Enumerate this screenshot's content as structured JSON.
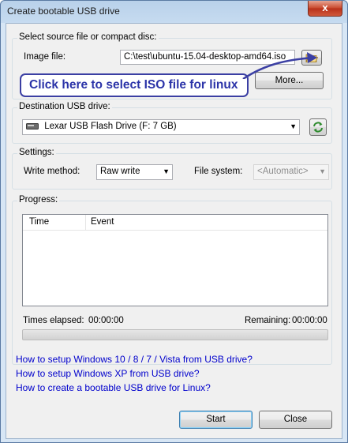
{
  "window": {
    "title": "Create bootable USB drive",
    "close_glyph": "x"
  },
  "source": {
    "legend": "Select source file or compact disc:",
    "image_label": "Image file:",
    "image_value": "C:\\test\\ubuntu-15.04-desktop-amd64.iso",
    "browse_icon": "folder-open-icon",
    "more_label": "More..."
  },
  "annotation": {
    "callout_text": "Click here to select ISO file for linux",
    "color": "#2b33a8"
  },
  "destination": {
    "legend": "Destination USB drive:",
    "selected_drive": "Lexar USB Flash Drive (F: 7 GB)",
    "refresh_icon": "refresh-icon"
  },
  "settings": {
    "legend": "Settings:",
    "write_method_label": "Write method:",
    "write_method_value": "Raw write",
    "file_system_label": "File system:",
    "file_system_value": "<Automatic>"
  },
  "progress": {
    "legend": "Progress:",
    "columns": [
      "Time",
      "Event"
    ],
    "elapsed_label": "Times elapsed:",
    "elapsed_value": "00:00:00",
    "remaining_label": "Remaining:",
    "remaining_value": "00:00:00",
    "percent": 0
  },
  "links": [
    "How to setup Windows 10 / 8 / 7 / Vista from USB drive?",
    "How to setup Windows XP from USB drive?",
    "How to create a bootable USB drive for Linux?"
  ],
  "buttons": {
    "start": "Start",
    "close": "Close"
  },
  "colors": {
    "link": "#0000cc",
    "titlebar": "#c6dbf0",
    "close_button": "#c9472b"
  }
}
